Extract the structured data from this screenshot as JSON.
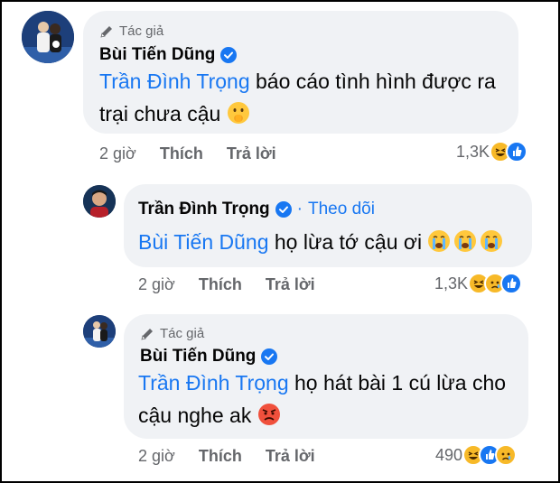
{
  "comments": [
    {
      "author_tag": "Tác giả",
      "author": "Bùi Tiến Dũng",
      "mention": "Trần Đình Trọng",
      "text_line1": " báo cáo tình hình được ra",
      "text_line2": "trại chưa cậu",
      "emoji": "shushing-face",
      "time": "2 giờ",
      "like": "Thích",
      "reply": "Trả lời",
      "reaction_count": "1,3K",
      "reactions": [
        "haha",
        "like"
      ]
    },
    {
      "author": "Trần Đình Trọng",
      "separator": "·",
      "follow": "Theo dõi",
      "mention": "Bùi Tiến Dũng",
      "text_line1": " họ lừa tớ cậu ơi",
      "emoji": "crying-face x3",
      "time": "2 giờ",
      "like": "Thích",
      "reply": "Trả lời",
      "reaction_count": "1,3K",
      "reactions": [
        "haha",
        "sad",
        "like"
      ]
    },
    {
      "author_tag": "Tác giả",
      "author": "Bùi Tiến Dũng",
      "mention": "Trần Đình Trọng",
      "text_line1": " họ hát bài 1 cú lừa cho",
      "text_line2": "cậu nghe ak",
      "emoji": "angry-face",
      "time": "2 giờ",
      "like": "Thích",
      "reply": "Trả lời",
      "reaction_count": "490",
      "reactions": [
        "haha",
        "like",
        "sad"
      ]
    }
  ],
  "colors": {
    "accent": "#1877f2",
    "bubble": "#f0f2f5",
    "muted": "#65676b"
  }
}
